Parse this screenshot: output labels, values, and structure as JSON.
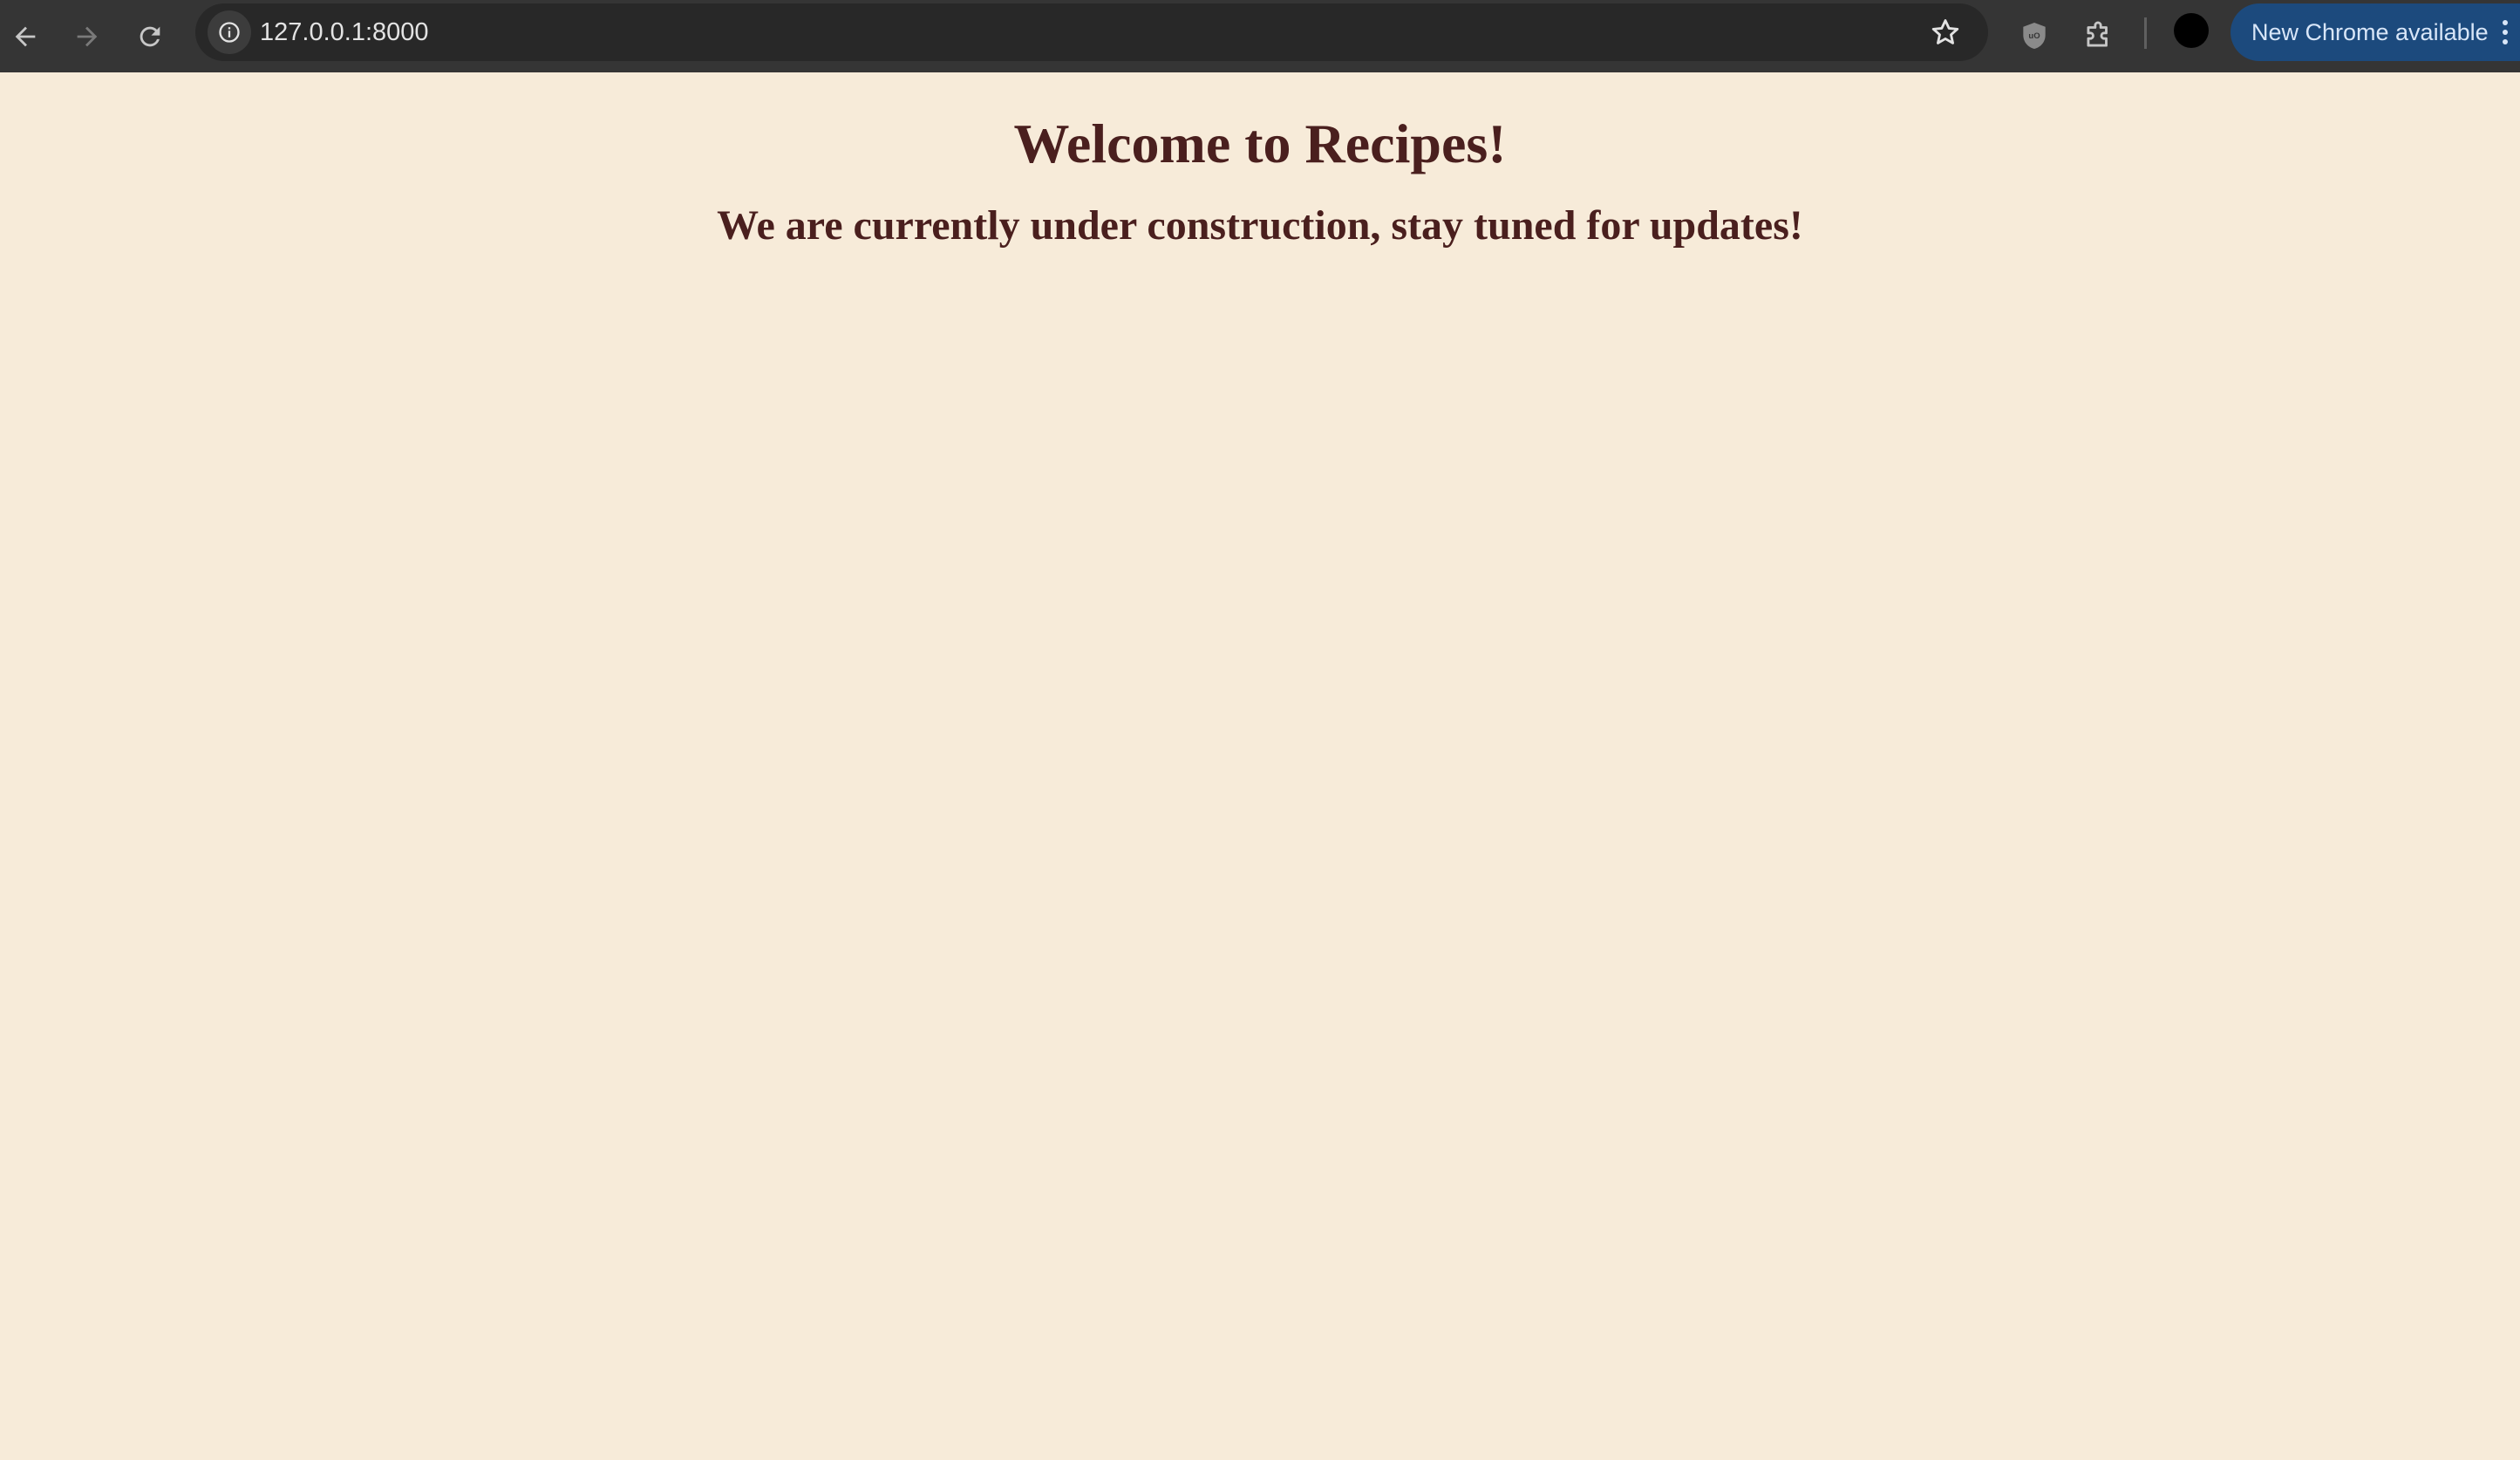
{
  "browser": {
    "url": "127.0.0.1:8000",
    "update_chip_label": "New Chrome available",
    "icons": {
      "back": "arrow-left-icon",
      "forward": "arrow-right-icon",
      "reload": "reload-icon",
      "site_info": "info-icon",
      "bookmark": "star-icon",
      "extension_shield": "shield-icon",
      "extensions": "puzzle-icon",
      "menu": "kebab-menu-icon"
    },
    "colors": {
      "toolbar": "#353535",
      "omnibox": "#282828",
      "update_chip": "#1c4a7d"
    }
  },
  "page": {
    "heading": "Welcome to Recipes!",
    "subheading": "We are currently under construction, stay tuned for updates!",
    "colors": {
      "background": "#f7ebd9",
      "text": "#4a1f1e"
    }
  }
}
